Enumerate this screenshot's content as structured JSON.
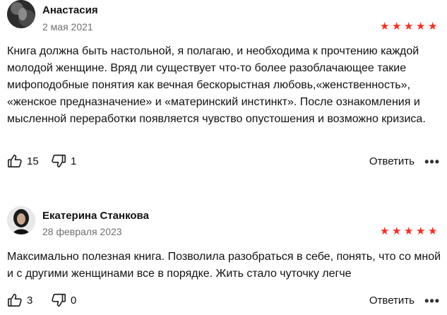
{
  "reviews": [
    {
      "author": "Анастасия",
      "date": "2 мая 2021",
      "rating": 5,
      "text": "Книга должна быть настольной, я полагаю, и необходима к прочтению каждой молодой женщине. Вряд ли существует что-то более разоблачающее такие мифоподобные понятия как вечная бескорыстная любовь,«женственность», «женское предназначение» и «материнский инстинкт». После ознакомления и мысленной переработки появляется чувство опустошения и возможно кризиса.",
      "likes": "15",
      "dislikes": "1",
      "reply_label": "Ответить",
      "more_label": "•••"
    },
    {
      "author": "Екатерина Станкова",
      "date": "28 февраля 2023",
      "rating": 5,
      "text": "Максимально полезная книга. Позволила разобраться в себе, понять, что со мной и с другими женщинами все в порядке. Жить стало чуточку легче",
      "likes": "3",
      "dislikes": "0",
      "reply_label": "Ответить",
      "more_label": "•••"
    }
  ],
  "colors": {
    "star": "#ff2a1a",
    "date": "#6f6f6f"
  },
  "icons": {
    "like": "thumbs-up-icon",
    "dislike": "thumbs-down-icon",
    "more": "more-dots-icon",
    "star": "star-icon"
  }
}
